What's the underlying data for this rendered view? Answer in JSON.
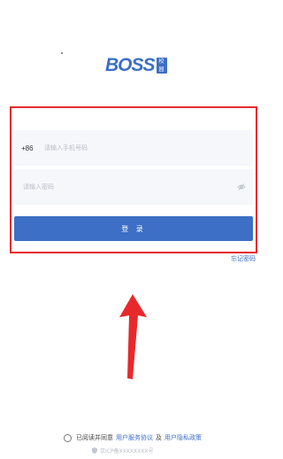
{
  "logo": {
    "text": "BOSS",
    "badge_top": "校",
    "badge_bottom": "园"
  },
  "login_form": {
    "phone": {
      "prefix": "+86",
      "placeholder": "请输入手机号码",
      "value": ""
    },
    "password": {
      "placeholder": "请输入密码",
      "value": ""
    },
    "submit_label": "登 录",
    "forgot_label": "忘记密码"
  },
  "agreement": {
    "prefix": "已阅读并同意",
    "service_link": "用户服务协议",
    "and": "及",
    "privacy_link": "用户隐私政策"
  },
  "footer": {
    "icp": "京ICP备XXXXXXXX号"
  },
  "icons": {
    "eye": "eye-icon",
    "shield": "shield-icon",
    "arrow": "red-arrow-up"
  },
  "colors": {
    "accent": "#3d6fc6",
    "highlight": "#e8292b",
    "field_bg": "#f5f7fb"
  }
}
